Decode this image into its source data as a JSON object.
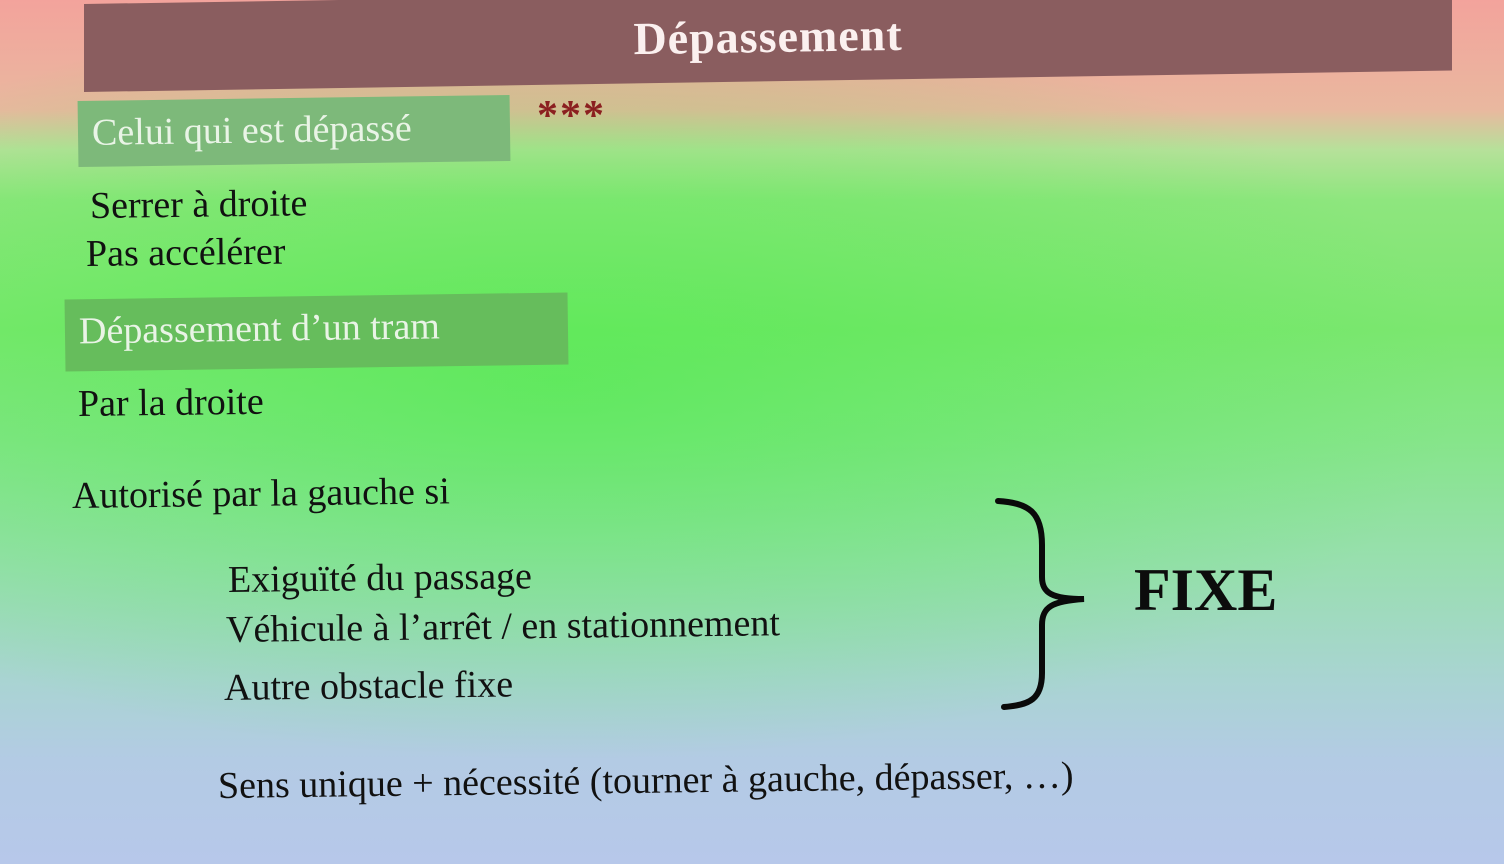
{
  "slide": {
    "title": "Dépassement",
    "stars": "***",
    "section1": {
      "heading": "Celui qui est dépassé",
      "lines": [
        "Serrer à droite",
        "Pas accélérer"
      ]
    },
    "section2": {
      "heading": "Dépassement d’un tram",
      "by_right": "Par la droite",
      "left_condition": "Autorisé par la gauche si",
      "conditions": [
        "Exiguïté du passage",
        "Véhicule à l’arrêt / en stationnement",
        "Autre obstacle fixe"
      ],
      "brace_label": "FIXE",
      "one_way": "Sens unique + nécessité (tourner à gauche, dépasser, …)"
    }
  },
  "colors": {
    "title_bar": "#8a5d5f",
    "section_box": "#7db97a",
    "stars": "#8b2020"
  }
}
